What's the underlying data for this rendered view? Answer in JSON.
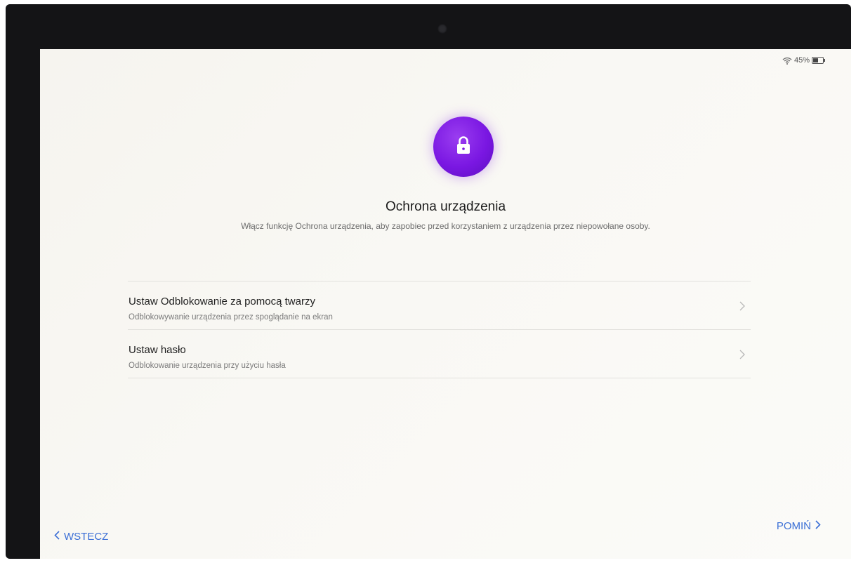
{
  "status_bar": {
    "battery_text": "45%",
    "icons": [
      "wifi-icon",
      "battery-icon"
    ]
  },
  "header": {
    "icon": "lock-icon",
    "title": "Ochrona urządzenia",
    "subtitle": "Włącz funkcję Ochrona urządzenia, aby zapobiec przed korzystaniem z urządzenia przez niepowołane osoby."
  },
  "options": [
    {
      "title": "Ustaw Odblokowanie za pomocą twarzy",
      "description": "Odblokowywanie urządzenia przez spoglądanie na ekran",
      "icon": "chevron-right-icon"
    },
    {
      "title": "Ustaw hasło",
      "description": "Odblokowanie urządzenia przy użyciu hasła",
      "icon": "chevron-right-icon"
    }
  ],
  "navigation": {
    "back_label": "WSTECZ",
    "skip_label": "POMIŃ"
  },
  "colors": {
    "accent": "#3b6fd6",
    "badge": "#7a17e2",
    "background": "#f9f8f4"
  }
}
